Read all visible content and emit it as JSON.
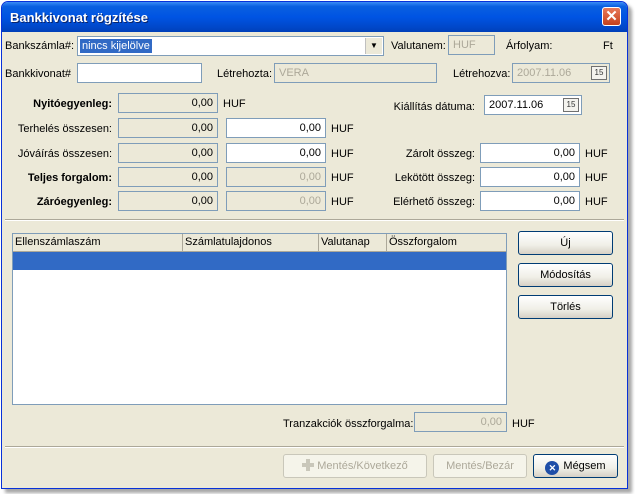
{
  "window": {
    "title": "Bankkivonat rögzítése"
  },
  "header": {
    "bankszamla_label": "Bankszámla#:",
    "bankszamla_value": "nincs kijelölve",
    "valutanem_label": "Valutanem:",
    "valutanem_value": "HUF",
    "arfolyam_label": "Árfolyam:",
    "arfolyam_value": "Ft",
    "bankkivonat_label": "Bankkivonat#",
    "bankkivonat_value": "",
    "letrehozta_label": "Létrehozta:",
    "letrehozta_value": "VERA",
    "letrehozva_label": "Létrehozva:",
    "letrehozva_value": "2007.11.06"
  },
  "totals": {
    "nyito_label": "Nyitóegyenleg:",
    "nyito_value": "0,00",
    "terheles_label": "Terhelés összesen:",
    "terheles_value": "0,00",
    "terheles_input": "0,00",
    "jovairas_label": "Jóváírás összesen:",
    "jovairas_value": "0,00",
    "jovairas_input": "0,00",
    "teljes_label": "Teljes forgalom:",
    "teljes_value": "0,00",
    "teljes_input": "0,00",
    "zaro_label": "Záróegyenleg:",
    "zaro_value": "0,00",
    "zaro_input": "0,00",
    "currency": "HUF"
  },
  "right_panel": {
    "kiallitas_label": "Kiállítás dátuma:",
    "kiallitas_value": "2007.11.06",
    "zarolt_label": "Zárolt összeg:",
    "zarolt_value": "0,00",
    "lekotott_label": "Lekötött összeg:",
    "lekotott_value": "0,00",
    "elerheto_label": "Elérhető összeg:",
    "elerheto_value": "0,00",
    "currency": "HUF"
  },
  "grid": {
    "columns": [
      "Ellenszámlaszám",
      "Számlatulajdonos",
      "Valutanap",
      "Összforgalom"
    ]
  },
  "side_buttons": {
    "new": "Új",
    "modify": "Módosítás",
    "delete": "Törlés"
  },
  "transactions": {
    "label": "Tranzakciók összforgalma:",
    "value": "0,00",
    "currency": "HUF"
  },
  "footer": {
    "save_next": "Mentés/Következő",
    "save_close": "Mentés/Bezár",
    "cancel": "Mégsem"
  },
  "icons": {
    "close": "close-icon",
    "calendar": "calendar-icon",
    "dropdown": "chevron-down-icon",
    "plus": "plus-icon",
    "cancel": "cancel-icon"
  }
}
